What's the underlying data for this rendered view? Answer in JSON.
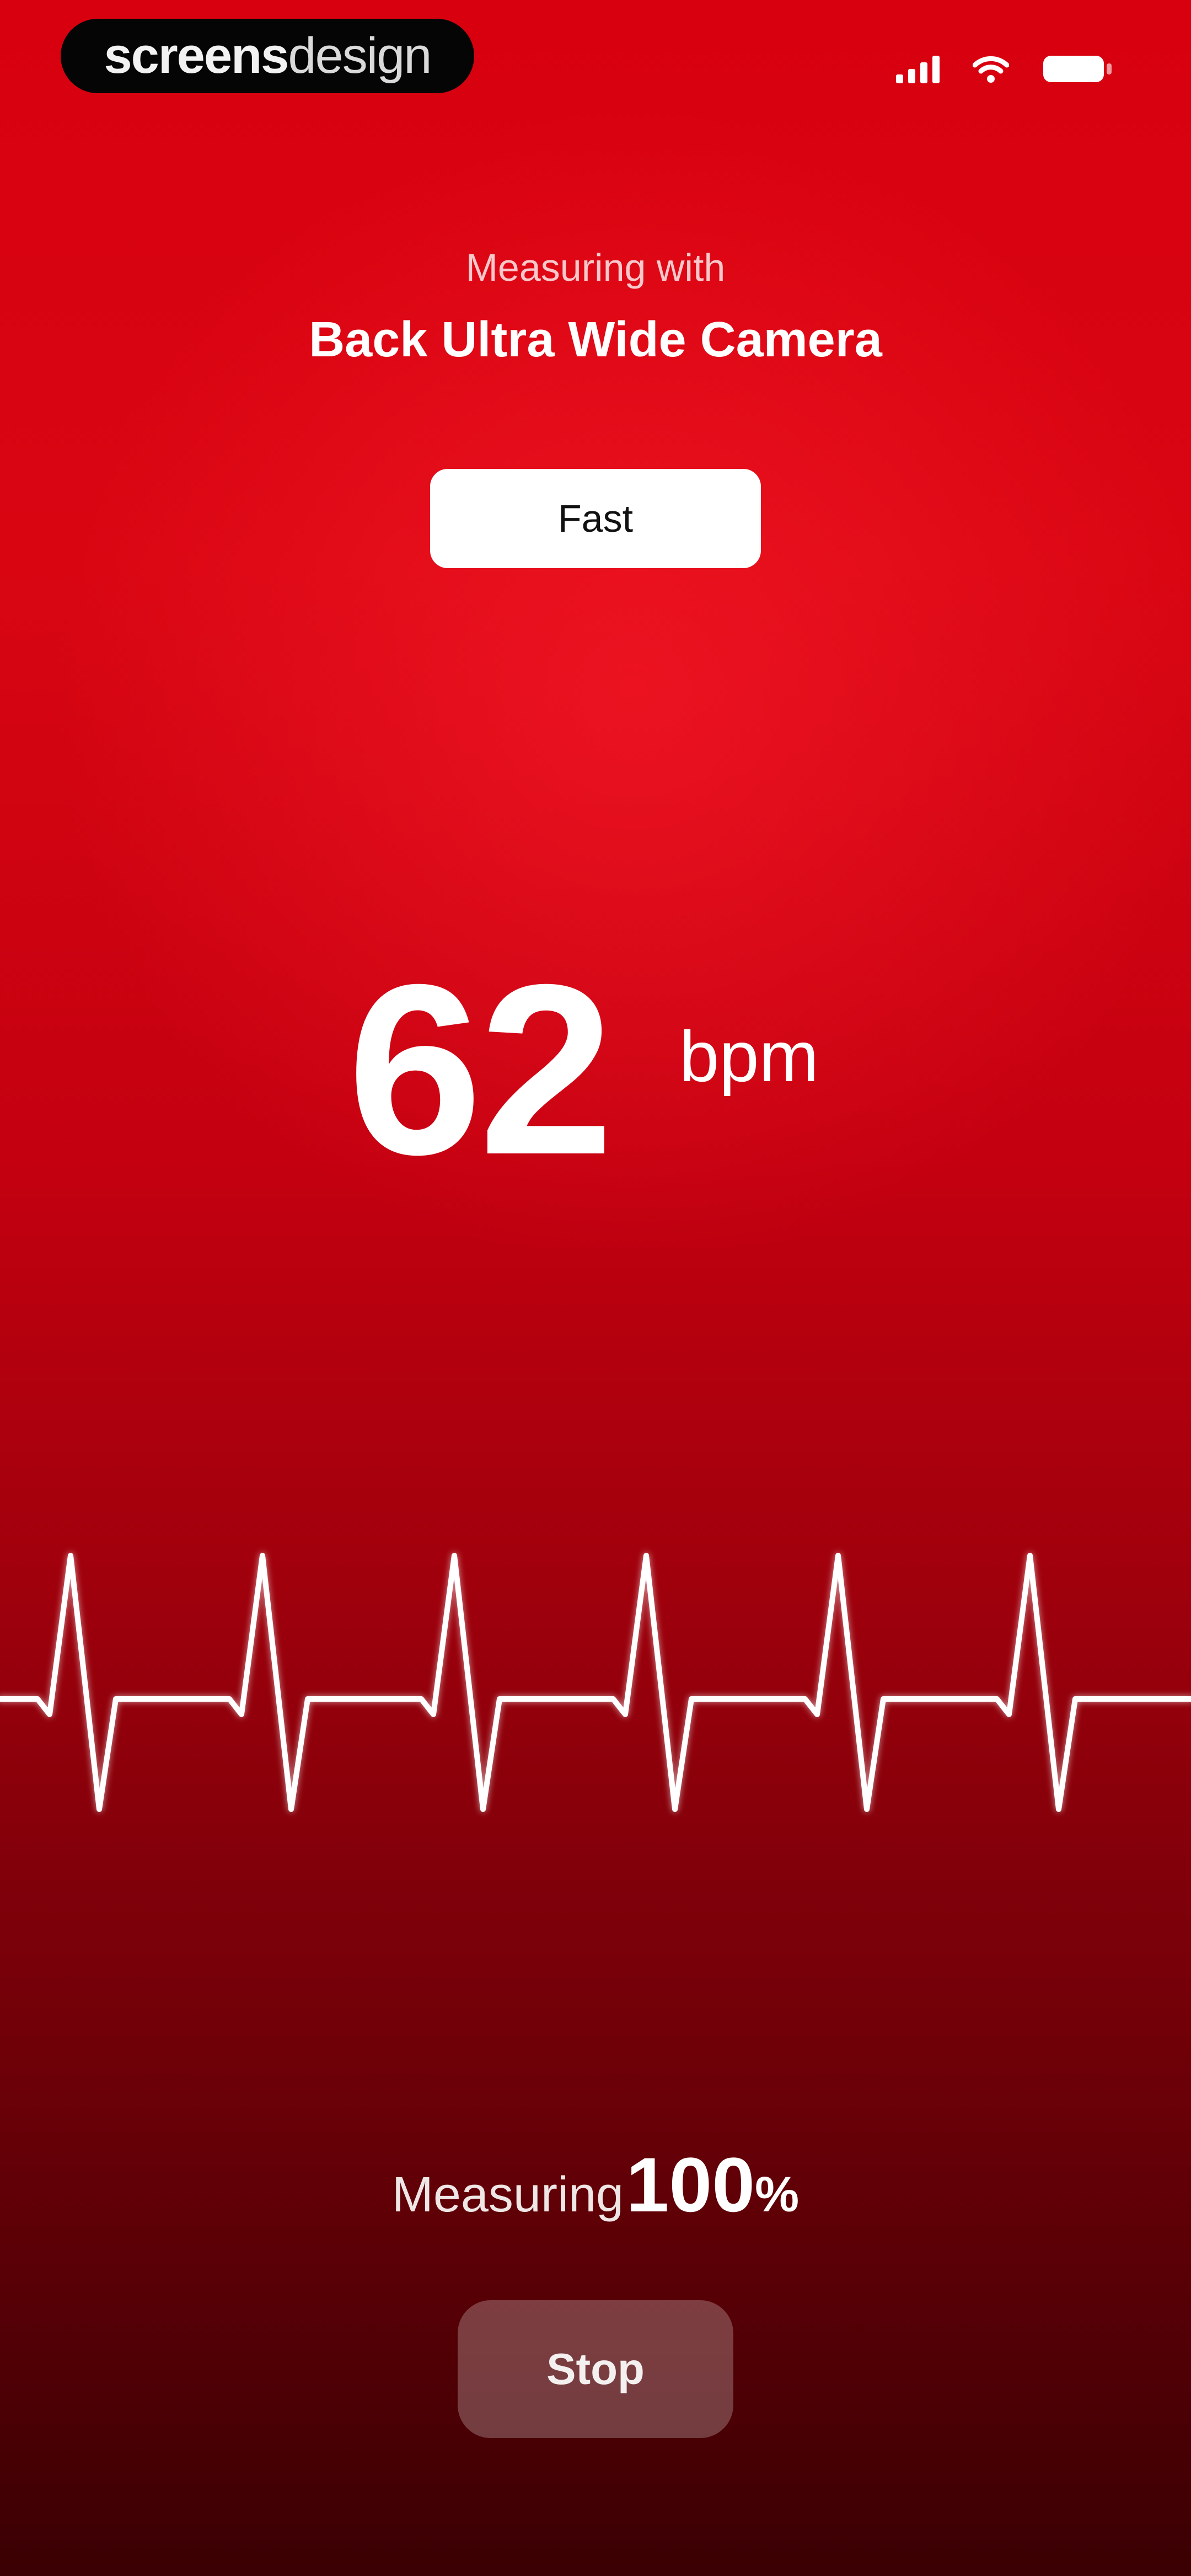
{
  "status_bar": {
    "brand_bold": "screens",
    "brand_light": "design",
    "icons": [
      "signal-icon",
      "wifi-icon",
      "battery-icon"
    ]
  },
  "header": {
    "measuring_with": "Measuring with",
    "camera_name": "Back Ultra Wide Camera"
  },
  "mode_button": {
    "label": "Fast"
  },
  "reading": {
    "value": "62",
    "unit": "bpm"
  },
  "progress": {
    "label": "Measuring",
    "value": "100",
    "unit": "%",
    "fraction": 1.0
  },
  "stop_button": {
    "label": "Stop"
  },
  "colors": {
    "background_top": "#d8000f",
    "background_bottom": "#3a0003",
    "wave_stroke": "#ffffff"
  }
}
